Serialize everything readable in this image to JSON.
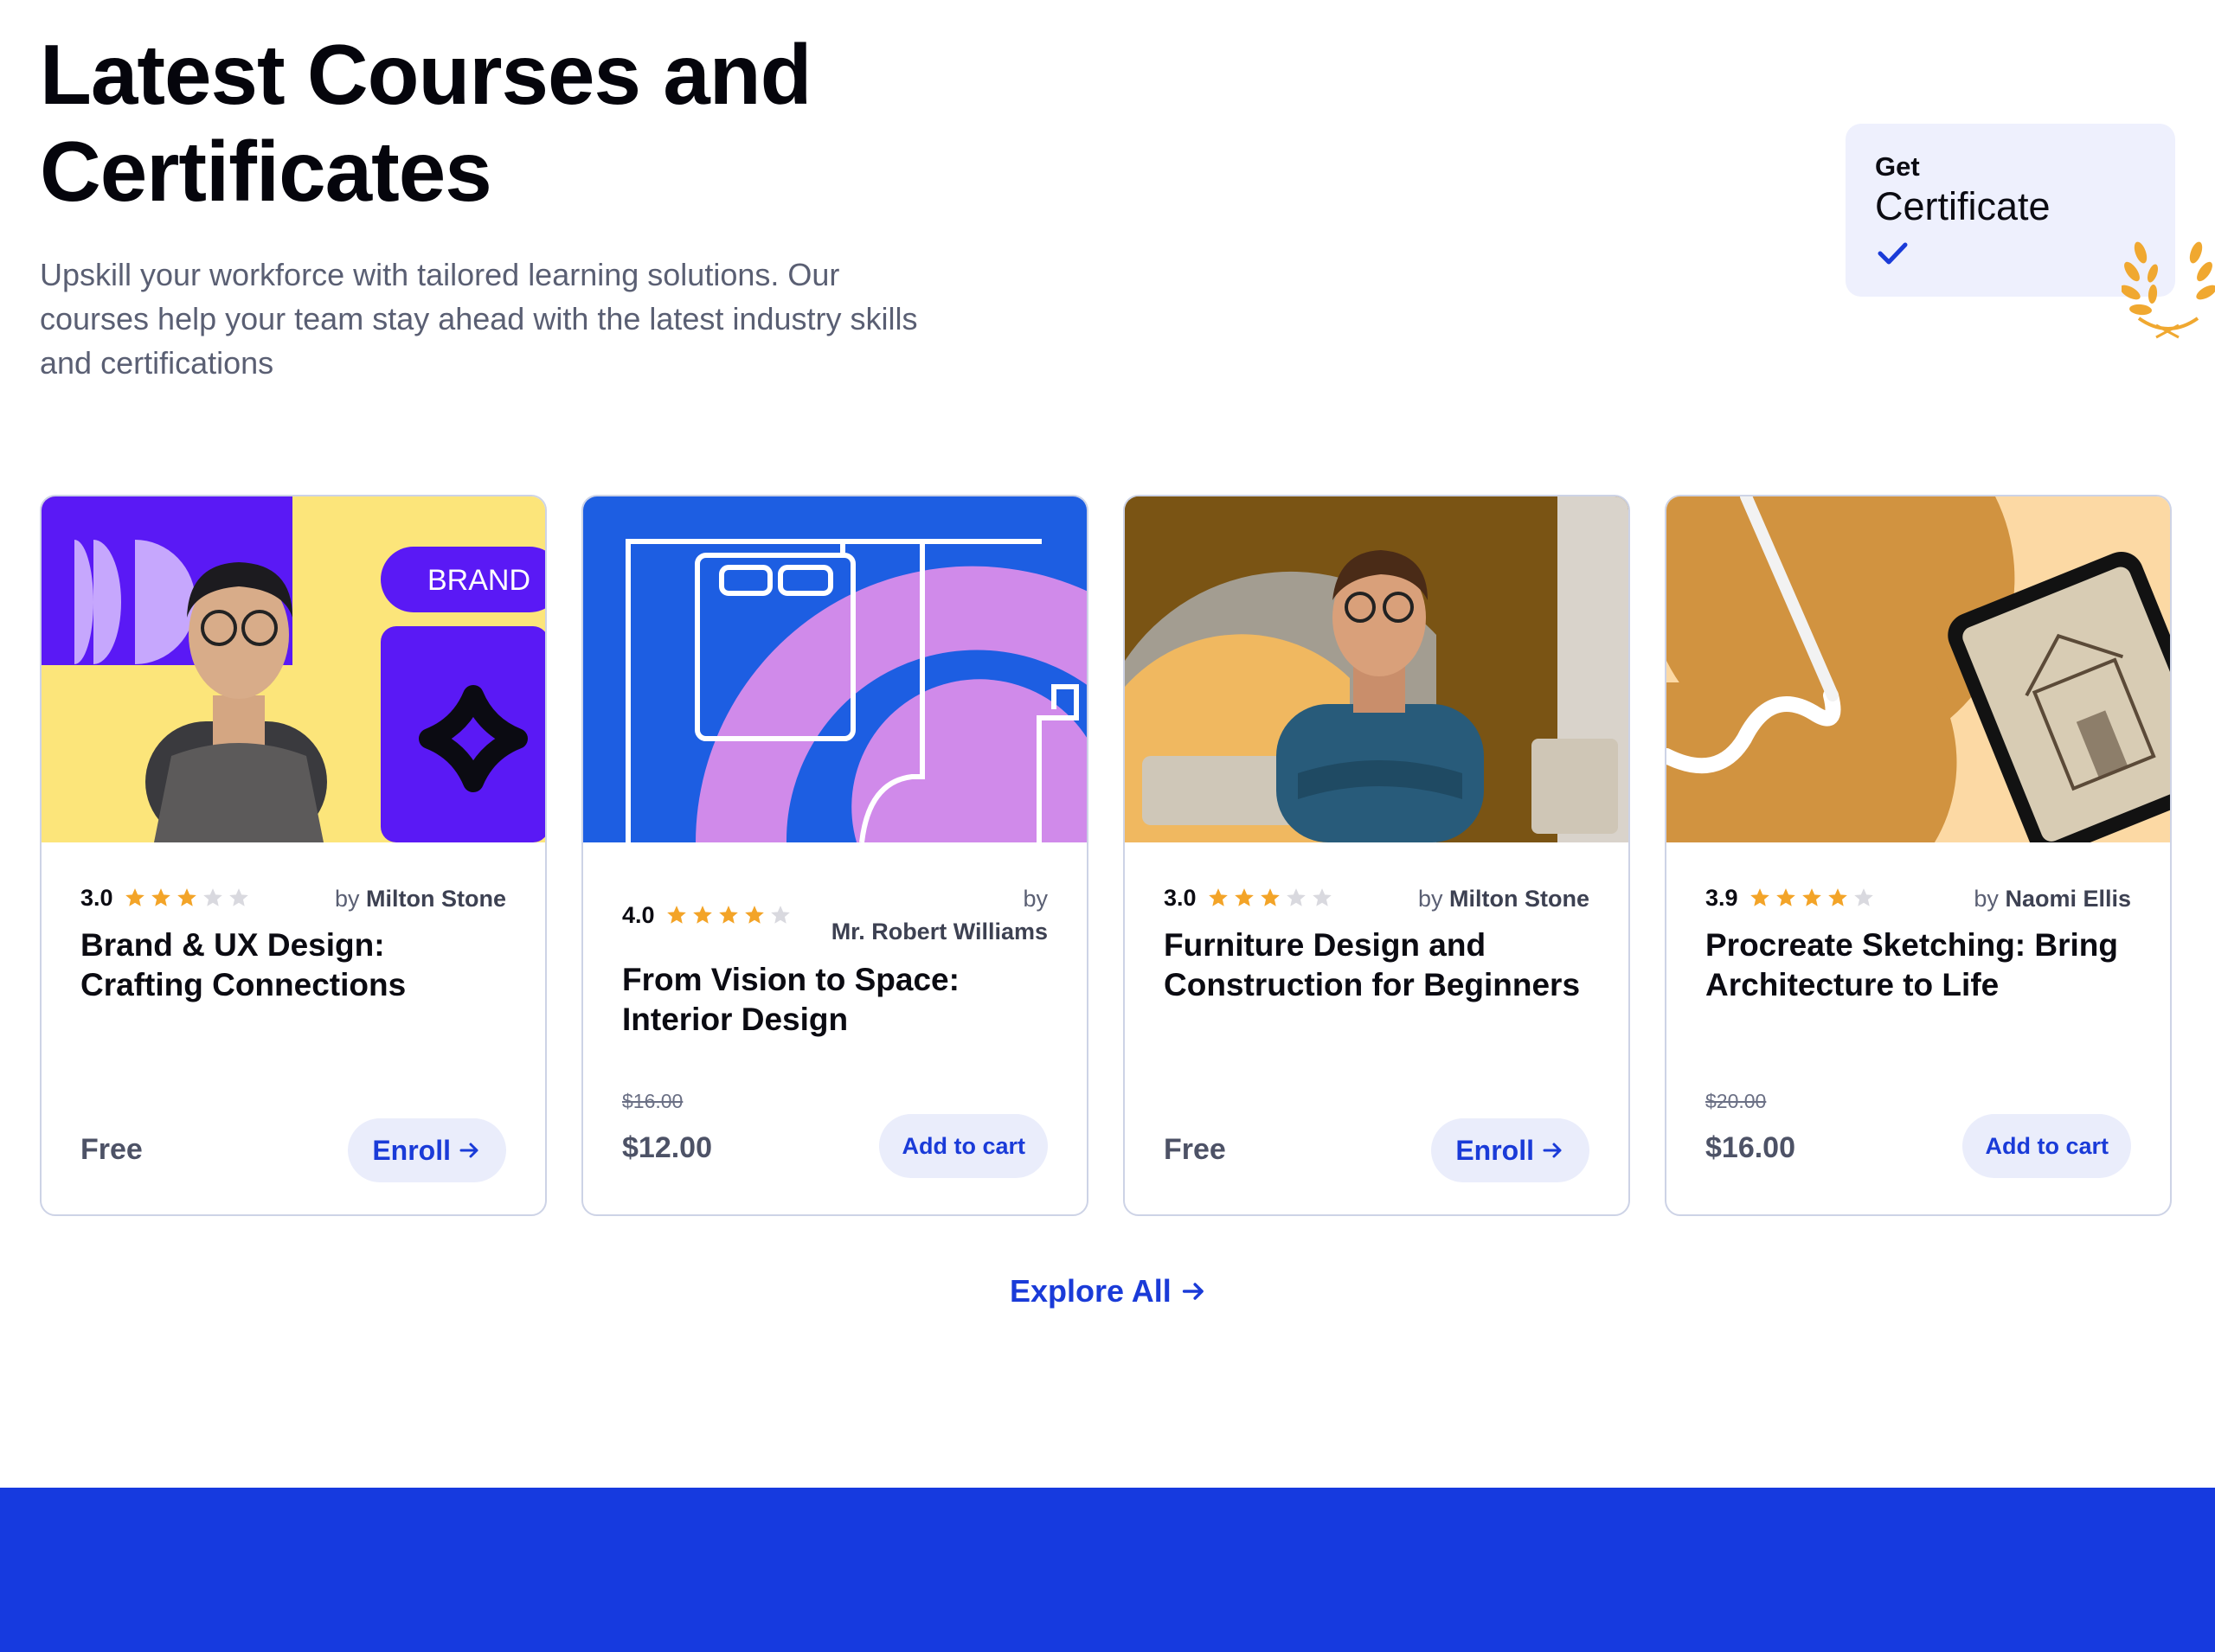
{
  "hero": {
    "title_line1": "Latest Courses and",
    "title_line2": "Certificates",
    "description": "Upskill your workforce with tailored learning solutions. Our courses help your team stay ahead with the latest industry skills and certifications"
  },
  "certificate_badge": {
    "small": "Get",
    "big": "Certificate"
  },
  "courses": [
    {
      "rating": "3.0",
      "stars": 3,
      "by": "by",
      "author": "Milton Stone",
      "title": "Brand & UX Design: Crafting Connections",
      "old_price": "",
      "price": "Free",
      "action": "Enroll",
      "image": {
        "label": "BRAND"
      }
    },
    {
      "rating": "4.0",
      "stars": 4,
      "by": "by",
      "author": "Mr. Robert Williams",
      "title": "From Vision to Space: Interior Design",
      "old_price": "$16.00",
      "price": "$12.00",
      "action": "Add to cart"
    },
    {
      "rating": "3.0",
      "stars": 3,
      "by": "by",
      "author": "Milton Stone",
      "title": "Furniture Design and Construction for Beginners",
      "old_price": "",
      "price": "Free",
      "action": "Enroll"
    },
    {
      "rating": "3.9",
      "stars": 4,
      "by": "by",
      "author": "Naomi Ellis",
      "title": "Procreate Sketching: Bring Architecture to Life",
      "old_price": "$20.00",
      "price": "$16.00",
      "action": "Add to cart"
    }
  ],
  "explore_all": "Explore All",
  "colors": {
    "accent": "#1a3bd8",
    "star": "#f3a428",
    "star_empty": "#d9d9df",
    "footer": "#163adf"
  }
}
